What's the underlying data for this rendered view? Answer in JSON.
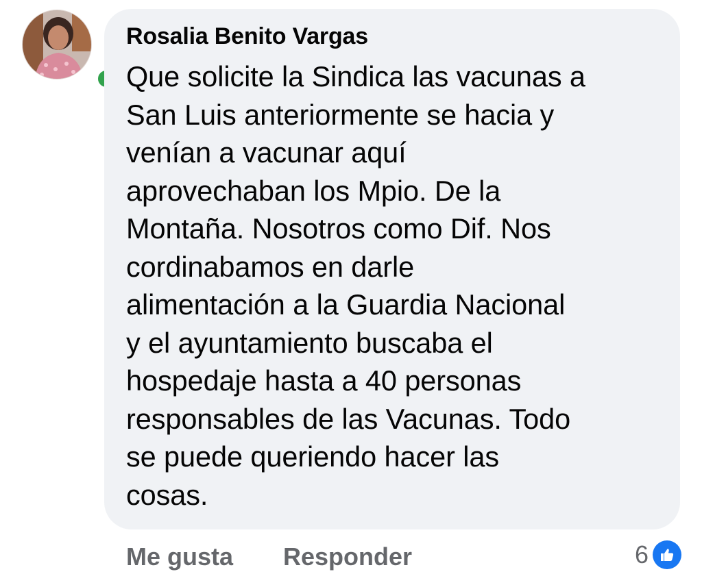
{
  "comment": {
    "author": "Rosalia Benito Vargas",
    "online": true,
    "text": "Que solicite la Sindica las vacunas a\nSan Luis anteriormente se hacia y\nvenían a vacunar aquí\naprovechaban los Mpio. De la\nMontaña.  Nosotros como Dif. Nos\ncordinabamos en darle\nalimentación a la Guardia Nacional\ny el ayuntamiento buscaba el\nhospedaje hasta a 40 personas\nresponsables de las Vacunas. Todo\nse puede queriendo hacer las\ncosas."
  },
  "actions": {
    "like_label": "Me gusta",
    "reply_label": "Responder"
  },
  "reactions": {
    "count": "6",
    "icon": "like-icon"
  },
  "colors": {
    "bubble_bg": "#f0f2f5",
    "online_dot": "#31a24c",
    "like_blue": "#1877f2",
    "secondary_text": "#65676b"
  }
}
